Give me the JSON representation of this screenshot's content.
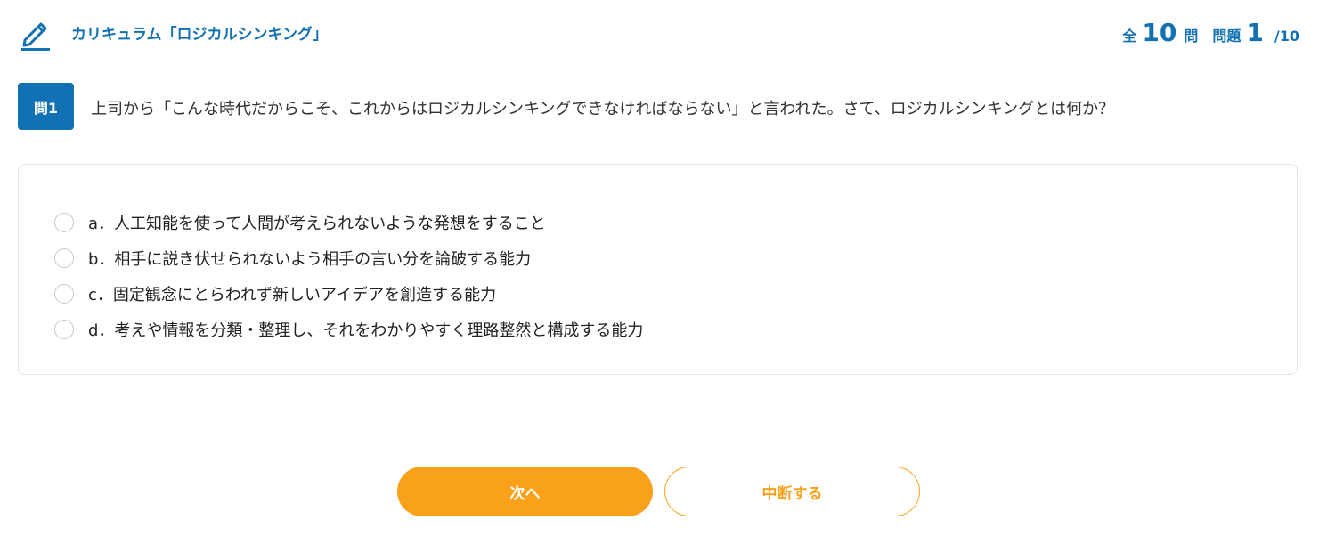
{
  "header": {
    "icon": "pencil-icon",
    "title": "カリキュラム「ロジカルシンキング」",
    "total_prefix": "全",
    "total_count": "10",
    "total_suffix": "問",
    "question_prefix": "問題",
    "current_question": "1",
    "question_total": "/10"
  },
  "question": {
    "badge": "問1",
    "text": "上司から「こんな時代だからこそ、これからはロジカルシンキングできなければならない」と言われた。さて、ロジカルシンキングとは何か？"
  },
  "options": [
    {
      "label": "a．人工知能を使って人間が考えられないような発想をすること"
    },
    {
      "label": "b．相手に説き伏せられないよう相手の言い分を論破する能力"
    },
    {
      "label": "c．固定観念にとらわれず新しいアイデアを創造する能力"
    },
    {
      "label": "d．考えや情報を分類・整理し、それをわかりやすく理路整然と構成する能力"
    }
  ],
  "footer": {
    "next_label": "次へ",
    "suspend_label": "中断する"
  },
  "colors": {
    "primary": "#1271b2",
    "accent": "#f9a11b"
  }
}
